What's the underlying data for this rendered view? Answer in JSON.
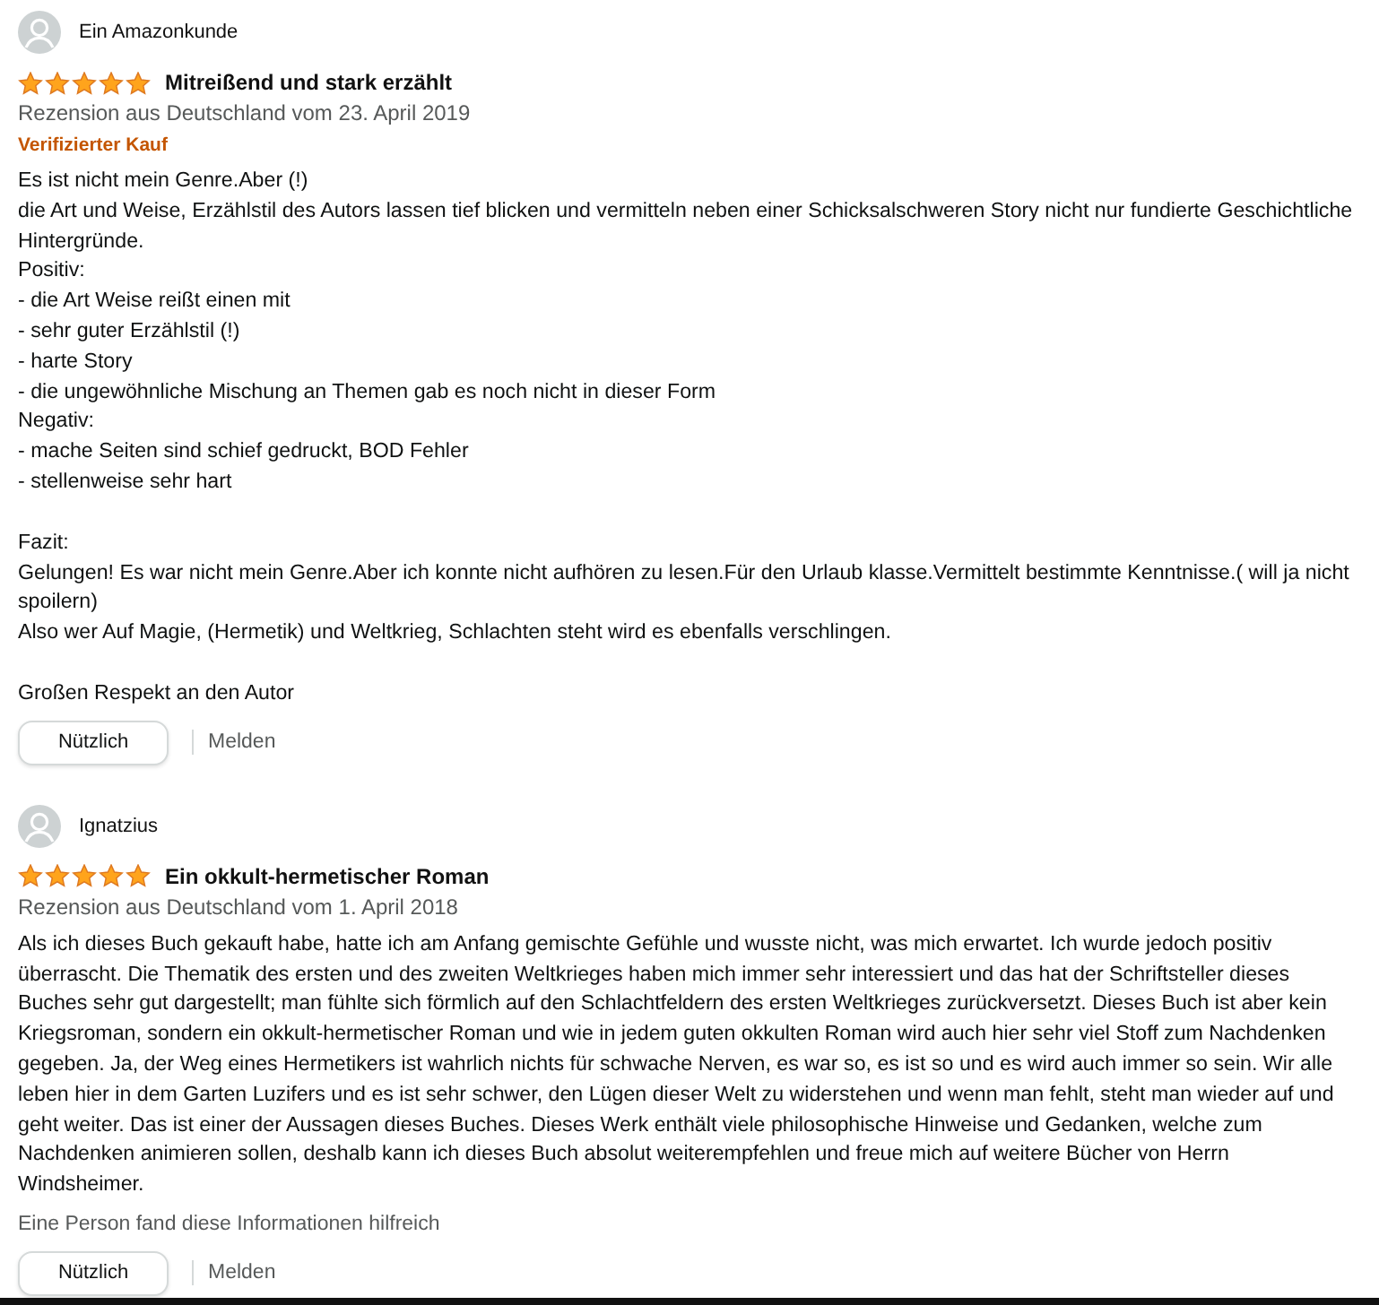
{
  "reviews": [
    {
      "author": "Ein Amazonkunde",
      "stars": 5,
      "title": "Mitreißend und stark erzählt",
      "meta": "Rezension aus Deutschland vom 23. April 2019",
      "badge": "Verifizierter Kauf",
      "body": [
        [
          "Es ist nicht mein Genre.Aber (!)",
          "die Art und Weise, Erzählstil des Autors lassen tief blicken und vermitteln neben einer Schicksalschweren Story nicht nur fundierte Geschichtliche Hintergründe.",
          "Positiv:",
          "- die Art Weise reißt einen mit",
          "- sehr guter Erzählstil (!)",
          "- harte Story",
          "- die ungewöhnliche Mischung an Themen gab es noch nicht in dieser Form",
          "Negativ:",
          "- mache Seiten sind schief gedruckt, BOD Fehler",
          "- stellenweise sehr hart"
        ],
        [
          "Fazit:",
          "Gelungen! Es war nicht mein Genre.Aber ich konnte nicht aufhören zu lesen.Für den Urlaub klasse.Vermittelt bestimmte Kenntnisse.( will ja nicht spoilern)",
          "Also wer Auf Magie, (Hermetik) und Weltkrieg, Schlachten steht wird es ebenfalls verschlingen."
        ],
        [
          "Großen Respekt an den Autor"
        ]
      ],
      "helpful_button": "Nützlich",
      "report_link": "Melden"
    },
    {
      "author": "Ignatzius",
      "stars": 5,
      "title": "Ein okkult-hermetischer Roman",
      "meta": "Rezension aus Deutschland vom 1. April 2018",
      "body": [
        [
          "Als ich dieses Buch gekauft habe, hatte ich am Anfang gemischte Gefühle und wusste nicht, was mich erwartet. Ich wurde jedoch positiv überrascht. Die Thematik des ersten und des zweiten Weltkrieges haben mich immer sehr interessiert und das hat der Schriftsteller dieses Buches sehr gut dargestellt; man fühlte sich förmlich auf den Schlachtfeldern des ersten Weltkrieges zurückversetzt. Dieses Buch ist aber kein Kriegsroman, sondern ein okkult-hermetischer Roman und wie in jedem guten okkulten Roman wird auch hier sehr viel Stoff zum Nachdenken gegeben. Ja, der Weg eines Hermetikers ist wahrlich nichts für schwache Nerven, es war so, es ist so und es wird auch immer so sein. Wir alle leben hier in dem Garten Luzifers und es ist sehr schwer, den Lügen dieser Welt zu widerstehen und wenn man fehlt, steht man wieder auf und geht weiter. Das ist einer der Aussagen dieses Buches. Dieses Werk enthält viele philosophische Hinweise und Gedanken, welche zum Nachdenken animieren sollen, deshalb kann ich dieses Buch absolut weiterempfehlen und freue mich auf weitere Bücher von Herrn Windsheimer."
        ]
      ],
      "helpful_count": "Eine Person fand diese Informationen hilfreich",
      "helpful_button": "Nützlich",
      "report_link": "Melden"
    }
  ]
}
